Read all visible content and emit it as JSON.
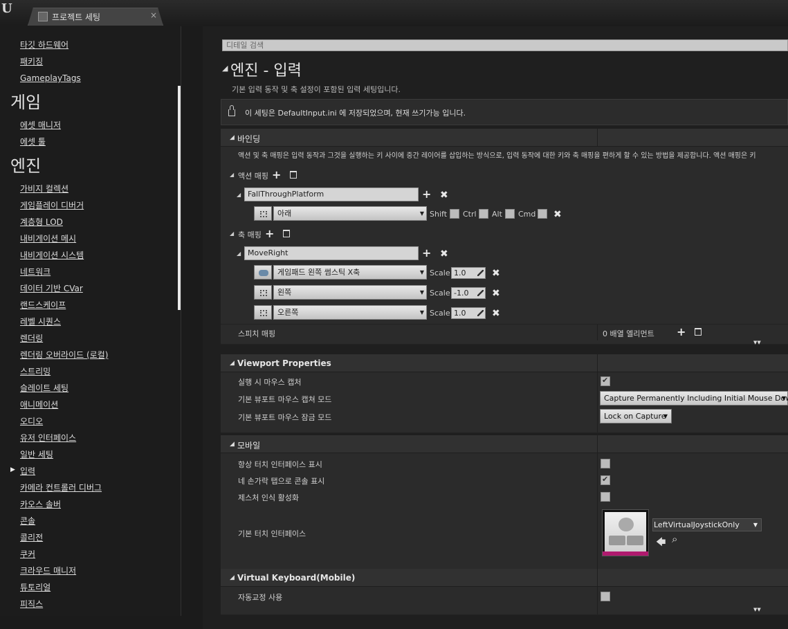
{
  "window": {
    "tab_title": "프로젝트 세팅",
    "close_glyph": "×",
    "logo": "U"
  },
  "sidebar": {
    "top_items": [
      "타깃 하드웨어",
      "패키징",
      "GameplayTags"
    ],
    "game_heading": "게임",
    "game_items": [
      "에셋 매니저",
      "에셋 툴"
    ],
    "engine_heading": "엔진",
    "engine_items": [
      "가비지 컬렉션",
      "게임플레이 디버거",
      "계층형 LOD",
      "내비게이션 메시",
      "내비게이션 시스템",
      "네트워크",
      "데이터 기반 CVar",
      "랜드스케이프",
      "레벨 시퀀스",
      "렌더링",
      "렌더링 오버라이드 (로컬)",
      "스트리밍",
      "슬레이트 세팅",
      "애니메이션",
      "오디오",
      "유저 인터페이스",
      "일반 세팅",
      "입력",
      "카메라 컨트롤러 디버그",
      "카오스 솔버",
      "콘솔",
      "콜리전",
      "쿠커",
      "크라우드 매니저",
      "튜토리얼",
      "피직스"
    ],
    "selected": "입력"
  },
  "main": {
    "search_placeholder": "디테일 검색",
    "title": "엔진 - 입력",
    "description": "기본 입력 동작 및 축 설정이 포함된 입력 세팅입니다.",
    "notice": "이 세팅은 DefaultInput.ini 에 저장되었으며, 현재 쓰기가능 입니다.",
    "bindings": {
      "title": "바인딩",
      "description": "액션 및 축 매핑은 입력 동작과 그것을 실행하는 키 사이에 중간 레이어를 삽입하는 방식으로, 입력 동작에 대한 키와 축 매핑을 편하게 할 수 있는 방법을 제공합니다. 액션 매핑은 키",
      "action_label": "액션 매핑",
      "action_name": "FallThroughPlatform",
      "action_key": "아래",
      "modifiers": [
        "Shift",
        "Ctrl",
        "Alt",
        "Cmd"
      ],
      "axis_label": "축 매핑",
      "axis_name": "MoveRight",
      "scale_label": "Scale",
      "axis_keys": [
        {
          "key": "게임패드 왼쪽 썸스틱 X축",
          "scale": "1.0"
        },
        {
          "key": "왼쪽",
          "scale": "-1.0"
        },
        {
          "key": "오른쪽",
          "scale": "1.0"
        }
      ],
      "speech_label": "스피치 매핑",
      "speech_value": "0 배열 엘리먼트"
    },
    "viewport": {
      "title": "Viewport Properties",
      "row1": "실행 시 마우스 캡처",
      "row2": "기본 뷰포트 마우스 캡쳐 모드",
      "row2_value": "Capture Permanently Including Initial Mouse Down",
      "row3": "기본 뷰포트 마우스 잠금 모드",
      "row3_value": "Lock on Capture"
    },
    "mobile": {
      "title": "모바일",
      "row1": "항상 터치 인터페이스 표시",
      "row2": "네 손가락 탭으로 콘솔 표시",
      "row3": "제스처 인식 활성화",
      "row4": "기본 터치 인터페이스",
      "row4_value": "LeftVirtualJoystickOnly"
    },
    "vkeyboard": {
      "title": "Virtual Keyboard(Mobile)",
      "row1": "자동교정 사용"
    }
  },
  "glyphs": {
    "plus": "+",
    "x": "✖",
    "tri_down": "◢",
    "dd": "▼",
    "expand": "▼▼",
    "back": "🡄",
    "search": "⌕"
  }
}
